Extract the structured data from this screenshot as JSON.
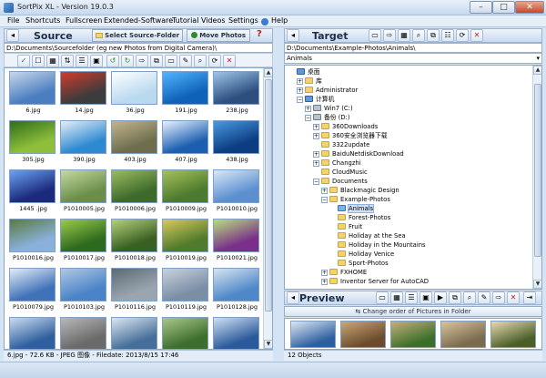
{
  "app": {
    "title": "SortPix XL - Version 19.0.3",
    "win_min": "–",
    "win_max": "□",
    "win_close": "✕"
  },
  "menu": [
    {
      "label": "File"
    },
    {
      "label": "Shortcuts"
    },
    {
      "label": "Fullscreen"
    },
    {
      "label": "Extended-Software"
    },
    {
      "label": "Tutorial Videos"
    },
    {
      "label": "Settings"
    },
    {
      "label": "Help"
    }
  ],
  "source": {
    "title": "Source",
    "select_btn": "Select Source-Folder",
    "move_btn": "Move Photos",
    "help_btn": "?",
    "path": "D:\\Documents\\Sourcefolder (eg new Photos from Digital Camera)\\",
    "thumbs": [
      {
        "name": "6.jpg",
        "c1": "#4a7ec0",
        "c2": "#c8d8e8"
      },
      {
        "name": "14.jpg",
        "c1": "#3c3c3c",
        "c2": "#d23c2a"
      },
      {
        "name": "36.jpg",
        "c1": "#b9d9ef",
        "c2": "#ffffff"
      },
      {
        "name": "191.jpg",
        "c1": "#0e62b8",
        "c2": "#52b5ff"
      },
      {
        "name": "238.jpg",
        "c1": "#2c4f80",
        "c2": "#9ec6e8"
      },
      {
        "name": "305.jpg",
        "c1": "#8fbf3a",
        "c2": "#2f6e1c"
      },
      {
        "name": "390.jpg",
        "c1": "#2d8ad1",
        "c2": "#e5eef7"
      },
      {
        "name": "403.jpg",
        "c1": "#6e6e4e",
        "c2": "#c3b58e"
      },
      {
        "name": "407.jpg",
        "c1": "#1c5fb0",
        "c2": "#e8f2ff"
      },
      {
        "name": "438.jpg",
        "c1": "#0c3c82",
        "c2": "#4a9ae0"
      },
      {
        "name": "1445 .jpg",
        "c1": "#1b2a7c",
        "c2": "#6da3f2"
      },
      {
        "name": "P1010005.jpg",
        "c1": "#6b8f4a",
        "c2": "#c5d9a2"
      },
      {
        "name": "P1010006.jpg",
        "c1": "#3e6a2c",
        "c2": "#9bbd5f"
      },
      {
        "name": "P1010009.jpg",
        "c1": "#4c7a2e",
        "c2": "#a6c25a"
      },
      {
        "name": "P1010010.jpg",
        "c1": "#5b8fd0",
        "c2": "#dbe8f5"
      },
      {
        "name": "P1010016.jpg",
        "c1": "#8ab1dc",
        "c2": "#5a7a40"
      },
      {
        "name": "P1010017.jpg",
        "c1": "#2e6a1e",
        "c2": "#9ccc4a"
      },
      {
        "name": "P1010018.jpg",
        "c1": "#3a5f22",
        "c2": "#b4d27a"
      },
      {
        "name": "P1010019.jpg",
        "c1": "#517a2c",
        "c2": "#d8c95c"
      },
      {
        "name": "P1010021.jpg",
        "c1": "#7a2f8a",
        "c2": "#b7e07a"
      },
      {
        "name": "P1010079.jpg",
        "c1": "#3f72b8",
        "c2": "#e3ecf5"
      },
      {
        "name": "P1010103.jpg",
        "c1": "#4a83c8",
        "c2": "#b0c8e0"
      },
      {
        "name": "P1010116.jpg",
        "c1": "#9aa5b0",
        "c2": "#5d6a72"
      },
      {
        "name": "P1010119.jpg",
        "c1": "#7a8ea6",
        "c2": "#c8d2dc"
      },
      {
        "name": "P1010128.jpg",
        "c1": "#4f88c9",
        "c2": "#d7e4ef"
      },
      {
        "name": "",
        "c1": "#2f5f9e",
        "c2": "#c9dcef"
      },
      {
        "name": "",
        "c1": "#6a6a6a",
        "c2": "#b8b8b8"
      },
      {
        "name": "",
        "c1": "#456f9a",
        "c2": "#dce6f0"
      },
      {
        "name": "",
        "c1": "#3d6e2e",
        "c2": "#aac88a"
      },
      {
        "name": "",
        "c1": "#2a5a9a",
        "c2": "#cfe0f2"
      }
    ],
    "status": "6.jpg - 72.6 KB - JPEG 图像 - Filedate: 2013/8/15 17:46"
  },
  "target": {
    "title": "Target",
    "path": "D:\\Documents\\Example-Photos\\Animals\\",
    "dropdown": "Animals",
    "tree": [
      {
        "label": "桌面",
        "depth": 0,
        "exp": "",
        "icon": "desktop"
      },
      {
        "label": "库",
        "depth": 1,
        "exp": "+",
        "icon": "folder"
      },
      {
        "label": "Administrator",
        "depth": 1,
        "exp": "+",
        "icon": "folder"
      },
      {
        "label": "计算机",
        "depth": 1,
        "exp": "-",
        "icon": "computer"
      },
      {
        "label": "Win7 (C:)",
        "depth": 2,
        "exp": "+",
        "icon": "drive"
      },
      {
        "label": "备份 (D:)",
        "depth": 2,
        "exp": "-",
        "icon": "drive"
      },
      {
        "label": "360Downloads",
        "depth": 3,
        "exp": "+",
        "icon": "folder"
      },
      {
        "label": "360安全浏览器下载",
        "depth": 3,
        "exp": "+",
        "icon": "folder"
      },
      {
        "label": "3322update",
        "depth": 3,
        "exp": "",
        "icon": "folder"
      },
      {
        "label": "BaiduNetdiskDownload",
        "depth": 3,
        "exp": "+",
        "icon": "folder"
      },
      {
        "label": "Changzhi",
        "depth": 3,
        "exp": "+",
        "icon": "folder"
      },
      {
        "label": "CloudMusic",
        "depth": 3,
        "exp": "",
        "icon": "folder"
      },
      {
        "label": "Documents",
        "depth": 3,
        "exp": "-",
        "icon": "folder"
      },
      {
        "label": "Blackmagic Design",
        "depth": 4,
        "exp": "+",
        "icon": "folder"
      },
      {
        "label": "Example-Photos",
        "depth": 4,
        "exp": "-",
        "icon": "folder"
      },
      {
        "label": "Animals",
        "depth": 5,
        "exp": "",
        "icon": "folder-open",
        "selected": true
      },
      {
        "label": "Forest-Photos",
        "depth": 5,
        "exp": "",
        "icon": "folder"
      },
      {
        "label": "Fruit",
        "depth": 5,
        "exp": "",
        "icon": "folder"
      },
      {
        "label": "Holiday at the Sea",
        "depth": 5,
        "exp": "",
        "icon": "folder"
      },
      {
        "label": "Holiday in the Mountains",
        "depth": 5,
        "exp": "",
        "icon": "folder"
      },
      {
        "label": "Holiday Venice",
        "depth": 5,
        "exp": "",
        "icon": "folder"
      },
      {
        "label": "Sport-Photos",
        "depth": 5,
        "exp": "",
        "icon": "folder"
      },
      {
        "label": "FXHOME",
        "depth": 4,
        "exp": "+",
        "icon": "folder"
      },
      {
        "label": "Inventor Server for AutoCAD",
        "depth": 4,
        "exp": "+",
        "icon": "folder"
      }
    ],
    "preview_title": "Preview",
    "order_btn": "Change order of Pictures in Folder",
    "previews": [
      {
        "c1": "#2d5fa0",
        "c2": "#dde8f3"
      },
      {
        "c1": "#6b4b2b",
        "c2": "#c9a878"
      },
      {
        "c1": "#3b6e2a",
        "c2": "#c5b07a"
      },
      {
        "c1": "#7a6a50",
        "c2": "#d8c49a"
      },
      {
        "c1": "#4a5e2a",
        "c2": "#e7d9b0"
      }
    ],
    "status": "12 Objects"
  }
}
